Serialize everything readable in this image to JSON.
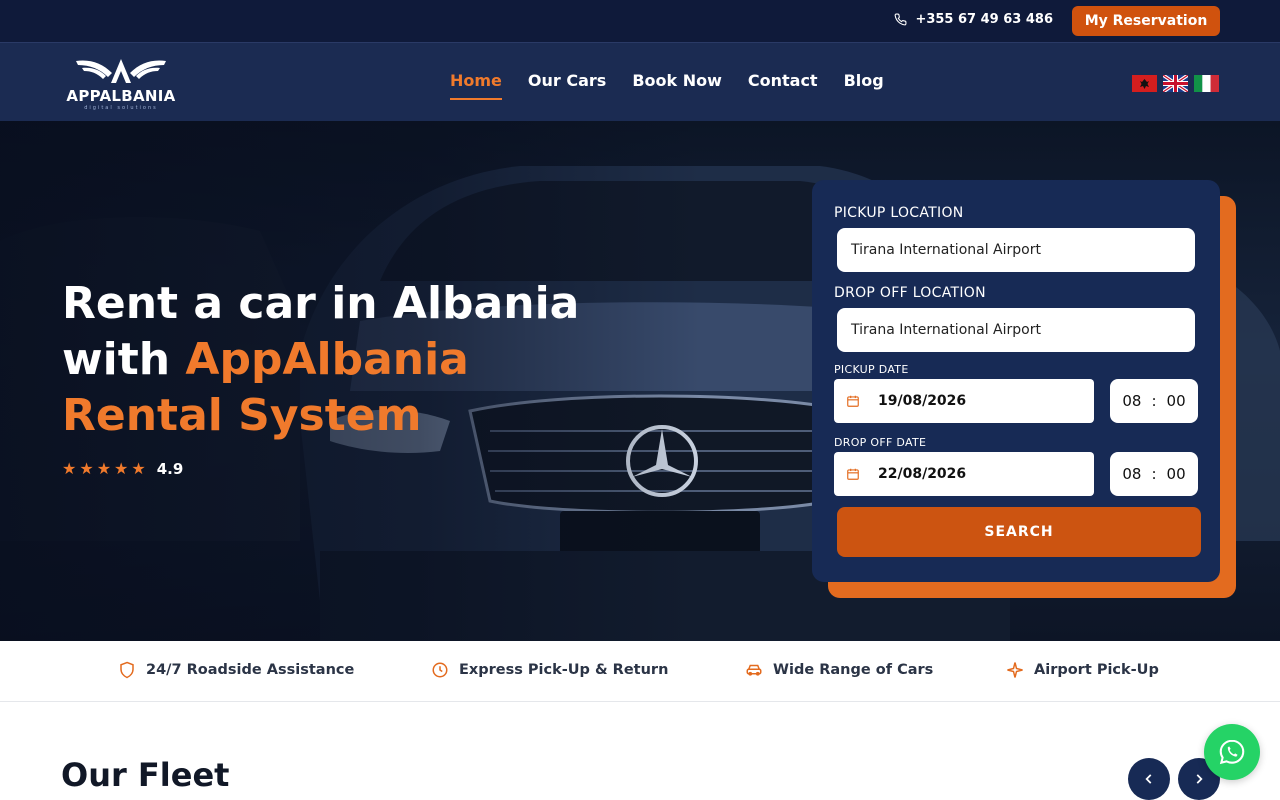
{
  "topbar": {
    "phone": "+355 67 49 63 486",
    "reservation_label": "My Reservation"
  },
  "brand": {
    "name": "APPALBANIA",
    "tagline": "digital solutions"
  },
  "nav": {
    "items": [
      {
        "label": "Home",
        "active": true
      },
      {
        "label": "Our Cars",
        "active": false
      },
      {
        "label": "Book Now",
        "active": false
      },
      {
        "label": "Contact",
        "active": false
      },
      {
        "label": "Blog",
        "active": false
      }
    ],
    "languages": [
      "albanian-flag-icon",
      "uk-flag-icon",
      "italian-flag-icon"
    ]
  },
  "hero": {
    "title_line1": "Rent a car in Albania",
    "title_line2_prefix": "with ",
    "title_line2_accent": "AppAlbania",
    "title_line3_accent": "Rental System",
    "rating_value": "4.9",
    "stars": 5
  },
  "booking": {
    "pickup_location_label": "PICKUP LOCATION",
    "pickup_location_value": "Tirana International Airport",
    "dropoff_location_label": "DROP OFF LOCATION",
    "dropoff_location_value": "Tirana International Airport",
    "pickup_date_label": "PICKUP DATE",
    "pickup_date_value": "19/08/2026",
    "pickup_hour": "08",
    "pickup_minute": "00",
    "dropoff_date_label": "DROP OFF DATE",
    "dropoff_date_value": "22/08/2026",
    "dropoff_hour": "08",
    "dropoff_minute": "00",
    "time_separator": ":",
    "search_label": "SEARCH"
  },
  "features": [
    {
      "icon": "shield-icon",
      "label": "24/7 Roadside Assistance"
    },
    {
      "icon": "clock-icon",
      "label": "Express Pick-Up & Return"
    },
    {
      "icon": "car-icon",
      "label": "Wide Range of Cars"
    },
    {
      "icon": "plane-icon",
      "label": "Airport Pick-Up"
    }
  ],
  "fleet": {
    "title": "Our Fleet"
  },
  "colors": {
    "navy": "#1b2b52",
    "topbar": "#0f1a3a",
    "accent": "#f07a2c",
    "button": "#d0520e",
    "whatsapp": "#25d366"
  }
}
